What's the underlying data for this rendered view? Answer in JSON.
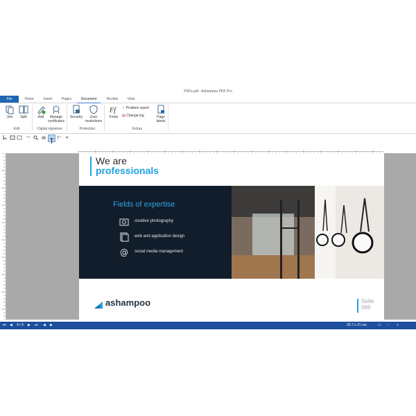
{
  "window": {
    "title": "PDFs.pdf - Ashampoo PDF Pro"
  },
  "tabs": [
    "File",
    "Home",
    "Insert",
    "Pages",
    "Document",
    "Review",
    "View"
  ],
  "ribbon": {
    "edit": {
      "join": "Join",
      "split": "Split",
      "group": "Edit"
    },
    "digital_signature": {
      "add": "Add",
      "manage": "Manage",
      "manage2": "certificates",
      "group": "Digital signature"
    },
    "protection": {
      "security": "Security",
      "user": "User",
      "user2": "restrictions",
      "group": "Protection"
    },
    "extras": {
      "fonts": "Fonts",
      "problem_report": "Problem report",
      "change_log": "Change log",
      "page": "Page",
      "labels": "labels",
      "group": "Extras"
    }
  },
  "page": {
    "heading_line1": "We are",
    "heading_line2": "professionals",
    "fields_title": "Fields of expertise",
    "fields": [
      "creative photography",
      "web and application design",
      "social media management"
    ],
    "logo": "ashampoo",
    "seite_label": "Seite",
    "seite_number": "069"
  },
  "status": {
    "page": "4 / 9",
    "size": "29.7 x 21 cm"
  },
  "colors": {
    "accent": "#1ea1e0",
    "band": "#111d2a",
    "statusbar": "#1e4f9e",
    "file_tab": "#1e66b1"
  }
}
